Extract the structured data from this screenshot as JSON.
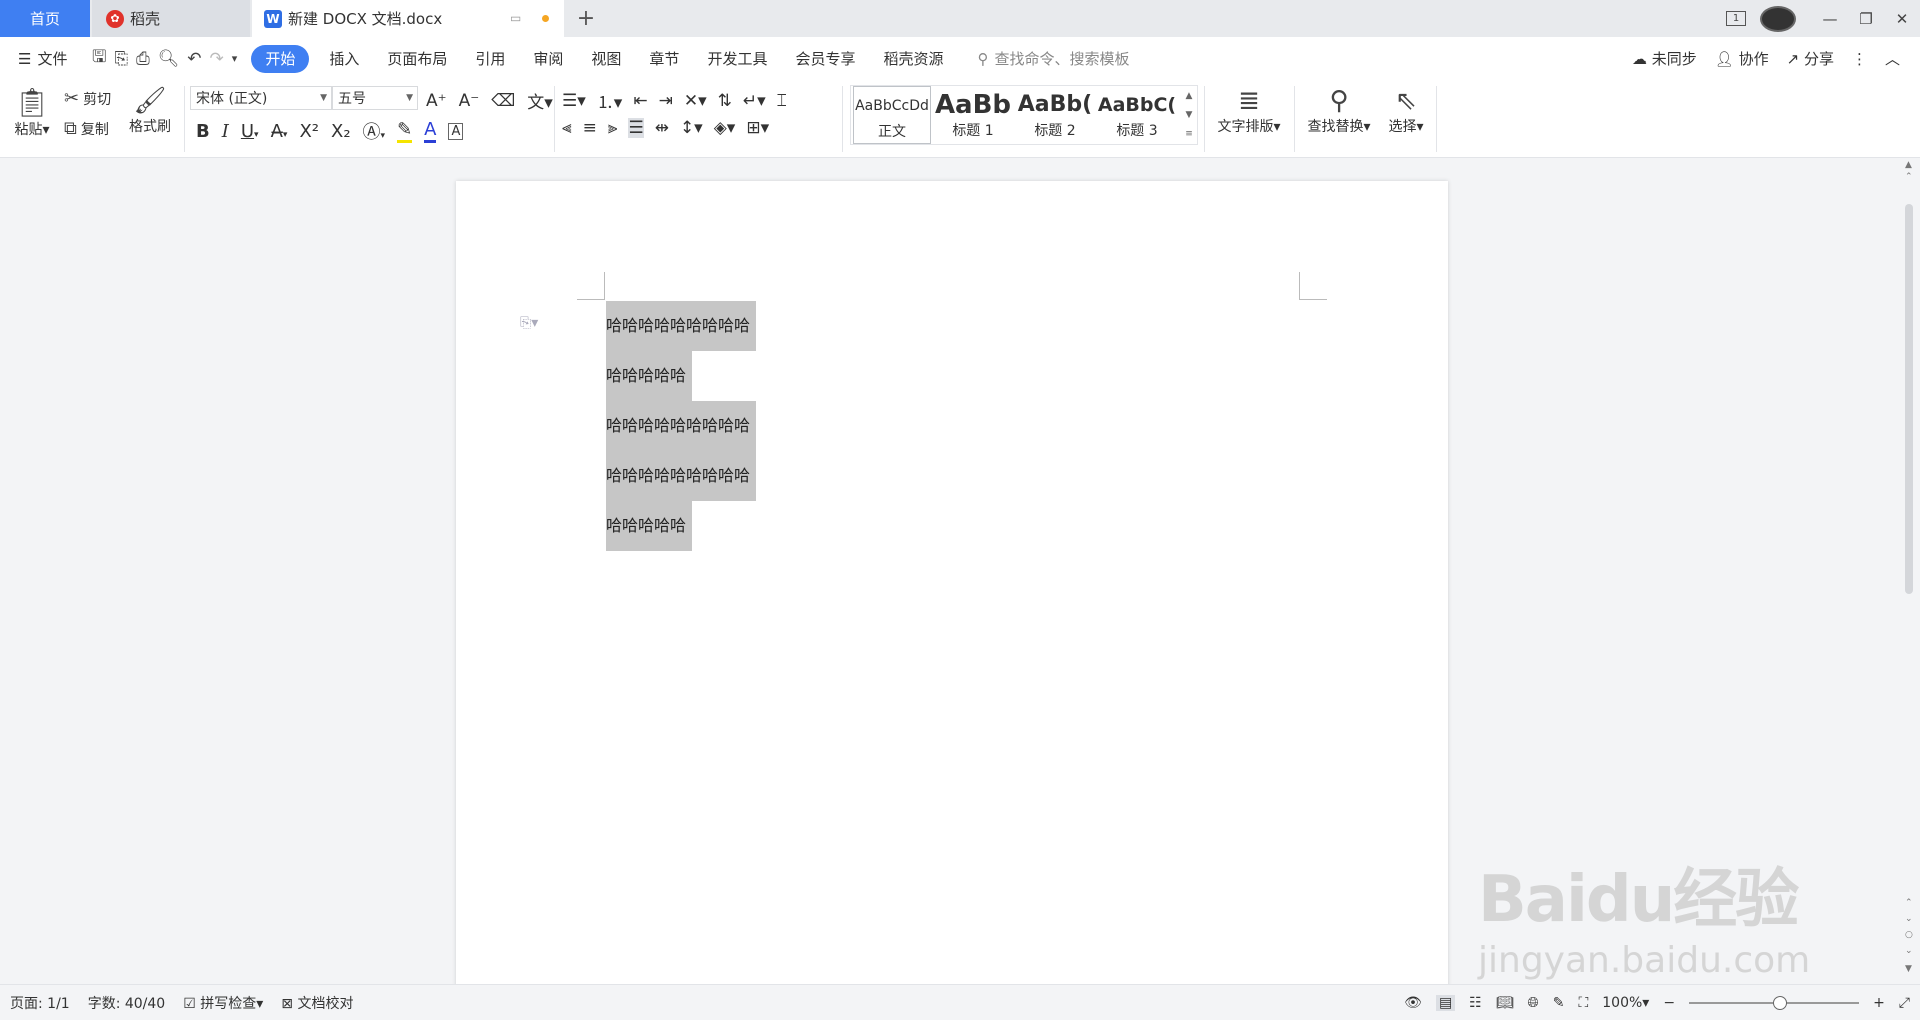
{
  "tabs": {
    "home": "首页",
    "daoke": "稻壳",
    "document": "新建 DOCX 文档.docx",
    "add": "+"
  },
  "window": {
    "count": "1",
    "minimize": "—",
    "restore": "❐",
    "close": "✕"
  },
  "menu": {
    "file": "文件",
    "tabs": [
      "开始",
      "插入",
      "页面布局",
      "引用",
      "审阅",
      "视图",
      "章节",
      "开发工具",
      "会员专享",
      "稻壳资源"
    ],
    "search_placeholder": "查找命令、搜索模板",
    "sync": "未同步",
    "collab": "协作",
    "share": "分享"
  },
  "ribbon": {
    "paste": "粘贴",
    "cut": "剪切",
    "copy": "复制",
    "format_painter": "格式刷",
    "font_name": "宋体 (正文)",
    "font_size": "五号",
    "bold": "B",
    "italic": "I",
    "underline": "U",
    "styles": [
      {
        "preview": "AaBbCcDd",
        "label": "正文"
      },
      {
        "preview": "AaBb",
        "label": "标题 1"
      },
      {
        "preview": "AaBb(",
        "label": "标题 2"
      },
      {
        "preview": "AaBbC(",
        "label": "标题 3"
      }
    ],
    "text_layout": "文字排版",
    "find_replace": "查找替换",
    "select": "选择"
  },
  "document": {
    "paragraphs": [
      "哈哈哈哈哈哈哈哈哈",
      "哈哈哈哈哈",
      "哈哈哈哈哈哈哈哈哈",
      "哈哈哈哈哈哈哈哈哈",
      "哈哈哈哈哈"
    ]
  },
  "status": {
    "page": "页面: 1/1",
    "words": "字数: 40/40",
    "spell": "拼写检查",
    "proofread": "文档校对",
    "zoom": "100%"
  },
  "watermark": {
    "brand": "Baidu经验",
    "url": "jingyan.baidu.com"
  },
  "colors": {
    "accent": "#3f7ff2",
    "selection": "#c6c6c6",
    "highlight": "#f5e400",
    "font_color": "#2b3fd6"
  }
}
